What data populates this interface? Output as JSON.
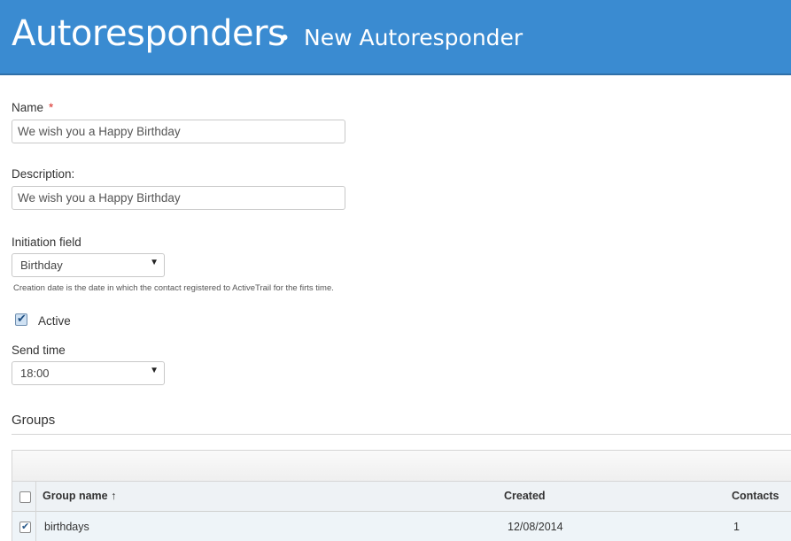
{
  "header": {
    "title": "Autoresponders",
    "separator": "•",
    "subtitle": "New Autoresponder"
  },
  "form": {
    "name_label": "Name",
    "name_required_mark": "*",
    "name_value": "We wish you a Happy Birthday",
    "description_label": "Description:",
    "description_value": "We wish you a Happy Birthday",
    "initiation_label": "Initiation field",
    "initiation_value": "Birthday",
    "initiation_hint": "Creation date is the date in which the contact registered to ActiveTrail for the firts time.",
    "active_label": "Active",
    "active_checked": true,
    "send_time_label": "Send time",
    "send_time_value": "18:00"
  },
  "groups": {
    "title": "Groups",
    "columns": {
      "name": "Group name ↑",
      "created": "Created",
      "contacts": "Contacts"
    },
    "rows": [
      {
        "name": "birthdays",
        "created": "12/08/2014",
        "contacts": "1",
        "checked": true
      }
    ]
  },
  "colors": {
    "header_bg": "#3a8bd1",
    "required": "#d9302a"
  },
  "icons": {
    "select_arrow": "caret-down-icon",
    "check": "checkmark-icon"
  }
}
